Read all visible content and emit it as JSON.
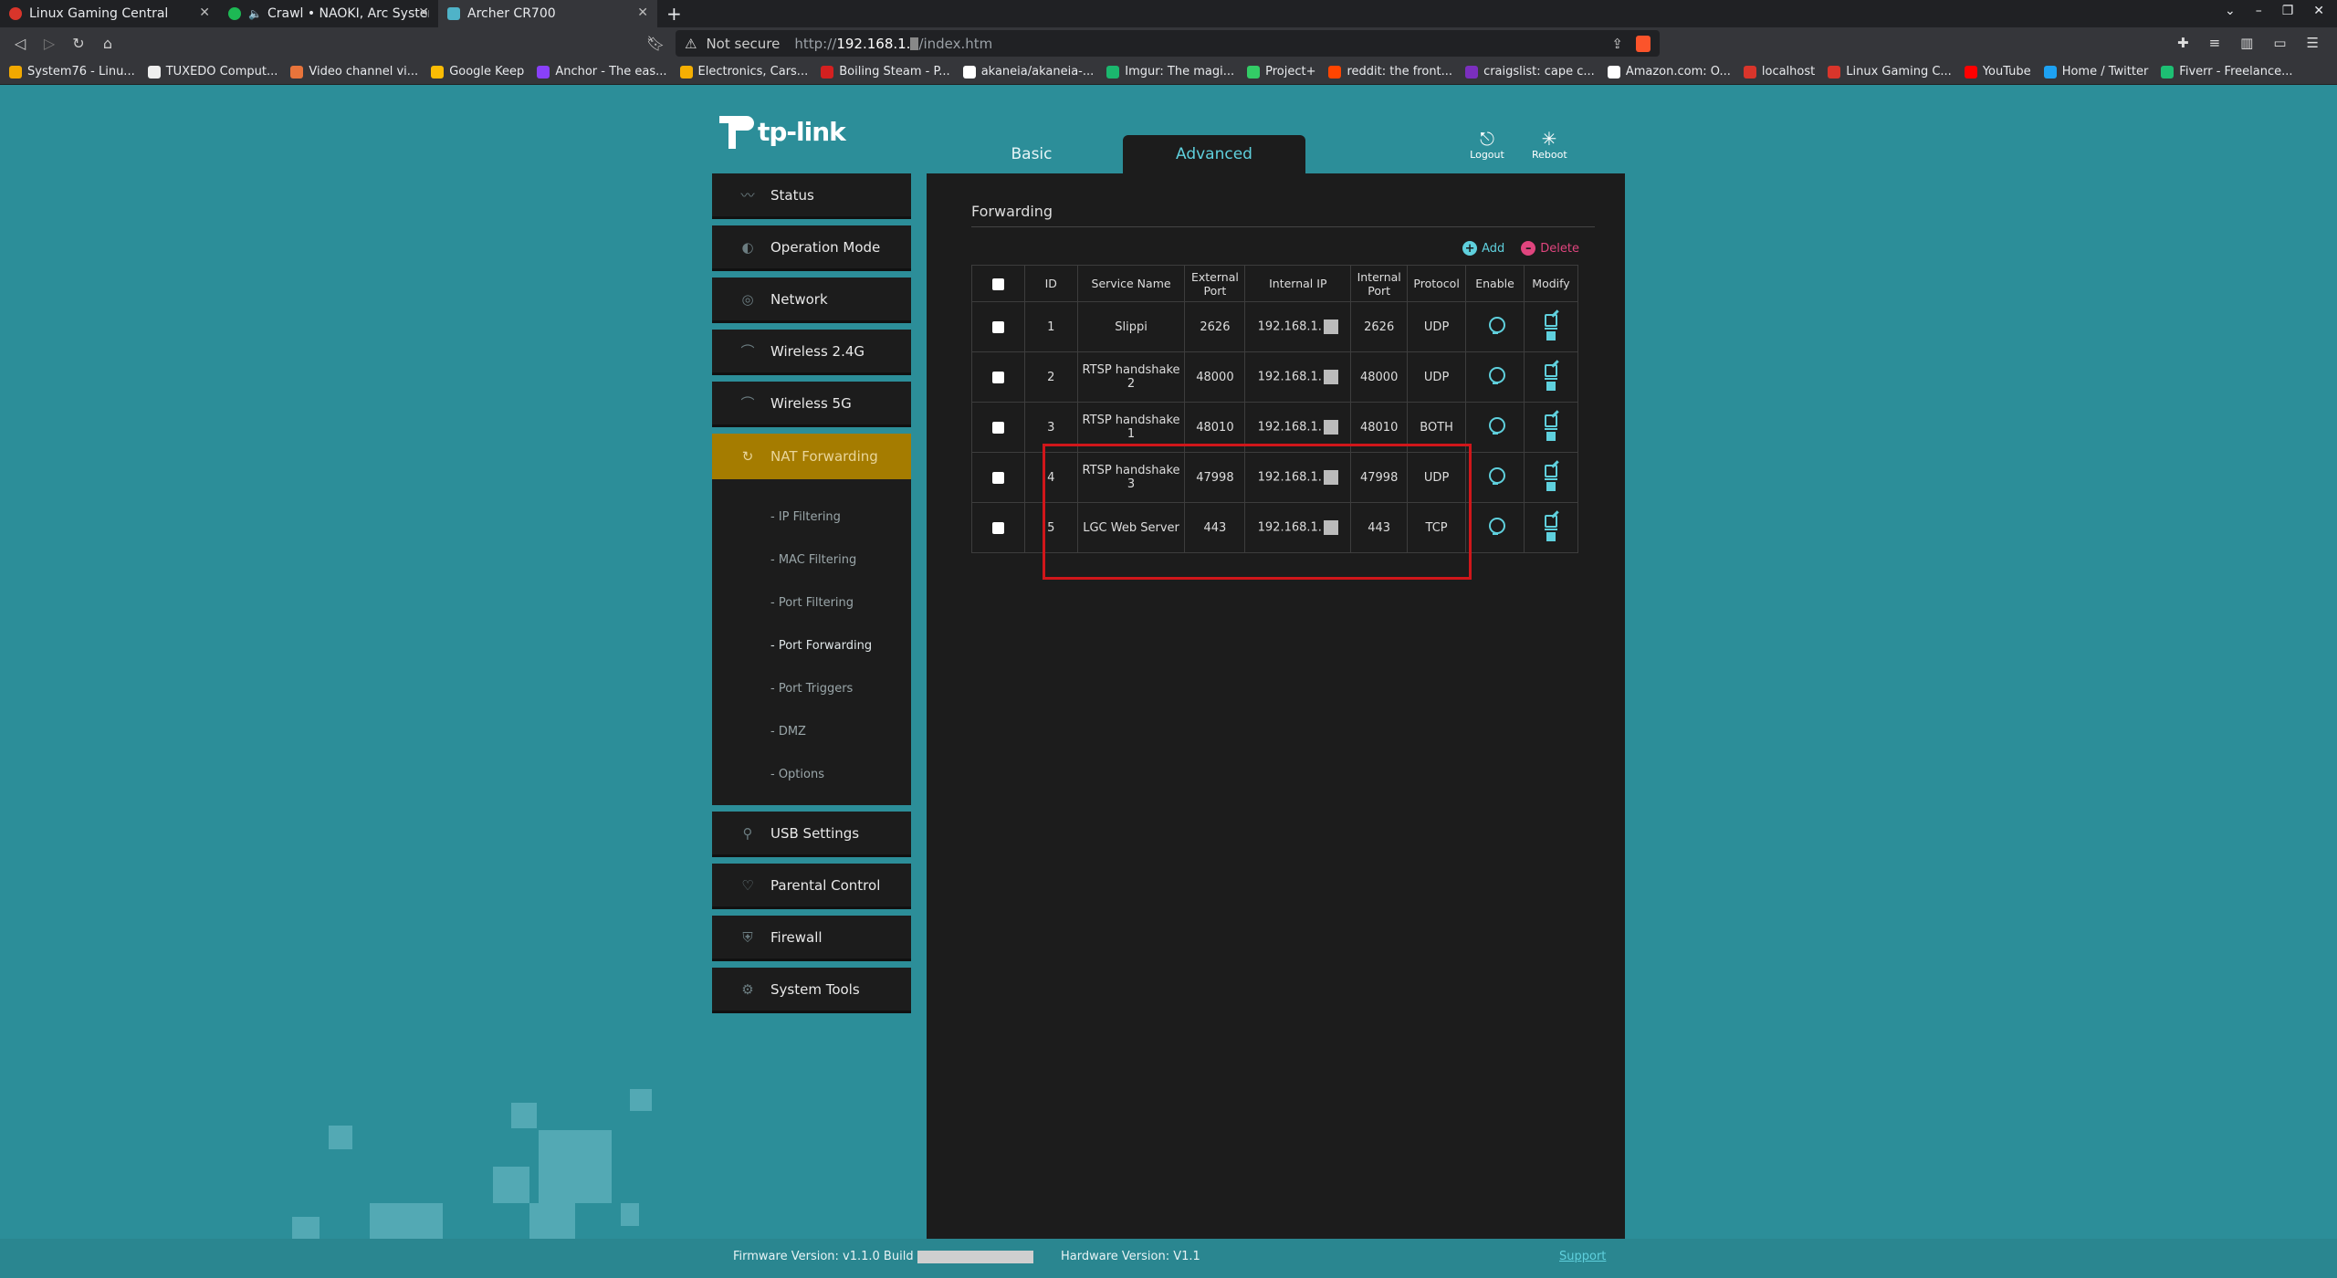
{
  "browser": {
    "tabs": [
      {
        "title": "Linux Gaming Central",
        "color": "#d9352b"
      },
      {
        "title": "Crawl • NAOKI, Arc System W",
        "color": "#1db954"
      },
      {
        "title": "Archer CR700",
        "color": "#4fb3c8"
      }
    ],
    "url": {
      "not_secure": "Not secure",
      "scheme": "http://",
      "host": "192.168.1.",
      "path": "/index.htm"
    },
    "bookmarks": [
      {
        "label": "System76 - Linu...",
        "color": "#f2a900"
      },
      {
        "label": "TUXEDO Comput...",
        "color": "#eeeeee"
      },
      {
        "label": "Video channel vi...",
        "color": "#e8743b"
      },
      {
        "label": "Google Keep",
        "color": "#fbbc04"
      },
      {
        "label": "Anchor - The eas...",
        "color": "#8940fa"
      },
      {
        "label": "Electronics, Cars...",
        "color": "#f5af02"
      },
      {
        "label": "Boiling Steam - P...",
        "color": "#d42020"
      },
      {
        "label": "akaneia/akaneia-...",
        "color": "#ffffff"
      },
      {
        "label": "Imgur: The magi...",
        "color": "#1bb76e"
      },
      {
        "label": "Project+",
        "color": "#33cc66"
      },
      {
        "label": "reddit: the front...",
        "color": "#ff4500"
      },
      {
        "label": "craigslist: cape c...",
        "color": "#7b2fbe"
      },
      {
        "label": "Amazon.com: O...",
        "color": "#ffffff"
      },
      {
        "label": "localhost",
        "color": "#d9352b"
      },
      {
        "label": "Linux Gaming C...",
        "color": "#d9352b"
      },
      {
        "label": "YouTube",
        "color": "#ff0000"
      },
      {
        "label": "Home / Twitter",
        "color": "#1da1f2"
      },
      {
        "label": "Fiverr - Freelance...",
        "color": "#1dbf73"
      }
    ]
  },
  "router": {
    "brand": "tp-link",
    "mode_tabs": [
      "Basic",
      "Advanced"
    ],
    "actions": {
      "logout": "Logout",
      "reboot": "Reboot"
    },
    "menu": [
      {
        "label": "Status",
        "icon": "pulse-icon"
      },
      {
        "label": "Operation Mode",
        "icon": "toggle-icon"
      },
      {
        "label": "Network",
        "icon": "globe-icon"
      },
      {
        "label": "Wireless 2.4G",
        "icon": "wifi-icon"
      },
      {
        "label": "Wireless 5G",
        "icon": "wifi-icon"
      },
      {
        "label": "NAT Forwarding",
        "icon": "refresh-icon"
      },
      {
        "label": "USB Settings",
        "icon": "usb-icon"
      },
      {
        "label": "Parental Control",
        "icon": "heart-icon"
      },
      {
        "label": "Firewall",
        "icon": "shield-icon"
      },
      {
        "label": "System Tools",
        "icon": "gear-icon"
      }
    ],
    "submenu": [
      "- IP Filtering",
      "- MAC Filtering",
      "- Port Filtering",
      "- Port Forwarding",
      "- Port Triggers",
      "- DMZ",
      "- Options"
    ],
    "forwarding": {
      "title": "Forwarding",
      "add": "Add",
      "delete": "Delete",
      "headers": [
        "ID",
        "Service Name",
        "External Port",
        "Internal IP",
        "Internal Port",
        "Protocol",
        "Enable",
        "Modify"
      ],
      "rows": [
        {
          "id": "1",
          "service": "Slippi",
          "ext_port": "2626",
          "ip": "192.168.1.",
          "int_port": "2626",
          "protocol": "UDP"
        },
        {
          "id": "2",
          "service": "RTSP handshake 2",
          "ext_port": "48000",
          "ip": "192.168.1.",
          "int_port": "48000",
          "protocol": "UDP"
        },
        {
          "id": "3",
          "service": "RTSP handshake 1",
          "ext_port": "48010",
          "ip": "192.168.1.",
          "int_port": "48010",
          "protocol": "BOTH"
        },
        {
          "id": "4",
          "service": "RTSP handshake 3",
          "ext_port": "47998",
          "ip": "192.168.1.",
          "int_port": "47998",
          "protocol": "UDP"
        },
        {
          "id": "5",
          "service": "LGC Web Server",
          "ext_port": "443",
          "ip": "192.168.1.",
          "int_port": "443",
          "protocol": "TCP"
        }
      ]
    },
    "footer": {
      "firmware": "Firmware Version: v1.1.0 Build",
      "hardware": "Hardware Version: V1.1",
      "support": "Support"
    }
  }
}
